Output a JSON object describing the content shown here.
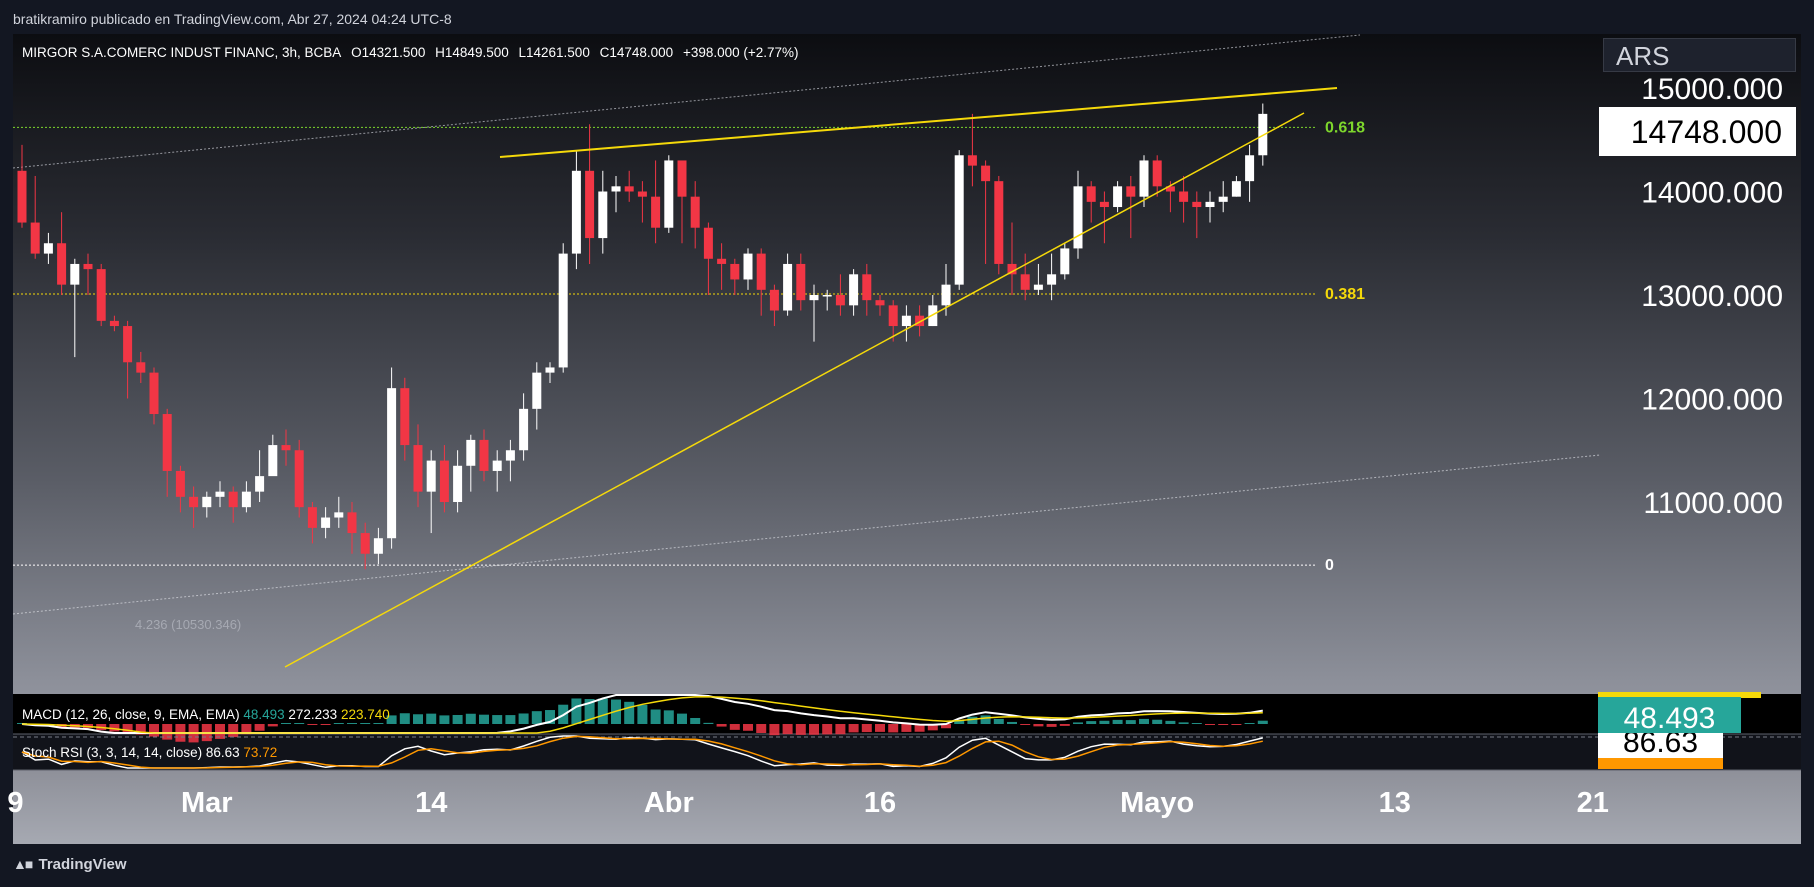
{
  "header": {
    "publish_line": "bratikramiro publicado en TradingView.com, Abr 27, 2024 04:24 UTC-8"
  },
  "legend": {
    "symbol": "MIRGOR S.A.COMERC INDUST FINANC, 3h, BCBA",
    "open": "O14321.500",
    "high": "H14849.500",
    "low": "L14261.500",
    "close": "C14748.000",
    "change": "+398.000 (+2.77%)"
  },
  "currency": "ARS",
  "last_price_tag": "14748.000",
  "macd": {
    "label": "MACD (12, 26, close, 9, EMA, EMA)",
    "hist_value": "48.493",
    "macd_value": "272.233",
    "signal_value": "223.740",
    "tag": "48.493"
  },
  "stoch_rsi": {
    "label": "Stoch RSI (3, 3, 14, 14, close)",
    "k_value": "86.63",
    "d_value": "73.72",
    "tag": "86.63"
  },
  "footer": {
    "brand": "TradingView"
  },
  "colors": {
    "up": "#ffffff",
    "down": "#f23645",
    "trendline": "#f5d90a",
    "fib_618": "#7dd62c",
    "fib_381": "#f5d90a",
    "macd_line": "#ffffff",
    "signal_line": "#f5d90a",
    "hist_pos": "#26a69a",
    "hist_neg": "#f23645",
    "rsi_k": "#ffffff",
    "rsi_d": "#ff9800"
  },
  "chart_data": {
    "type": "candlestick",
    "title": "MIRGOR S.A.COMERC INDUST FINANC, 3h, BCBA",
    "y_axis": {
      "ticks": [
        {
          "value": 11000,
          "label": "11000.000"
        },
        {
          "value": 12000,
          "label": "12000.000"
        },
        {
          "value": 13000,
          "label": "13000.000"
        },
        {
          "value": 14000,
          "label": "14000.000"
        },
        {
          "value": 15000,
          "label": "15000.000"
        }
      ],
      "range": [
        10000,
        15500
      ]
    },
    "x_axis": {
      "ticks": [
        {
          "i": -0.5,
          "label": "9"
        },
        {
          "i": 14,
          "label": "Mar"
        },
        {
          "i": 31,
          "label": "14"
        },
        {
          "i": 49,
          "label": "Abr"
        },
        {
          "i": 65,
          "label": "16"
        },
        {
          "i": 86,
          "label": "Mayo"
        },
        {
          "i": 104,
          "label": "13"
        },
        {
          "i": 119,
          "label": "21"
        }
      ]
    },
    "fib_levels": [
      {
        "label": "0.618",
        "value": 14620
      },
      {
        "label": "0.381",
        "value": 13010
      },
      {
        "label": "0",
        "value": 10390
      }
    ],
    "fib_extension_label": "4.236 (10530.346)",
    "candles": [
      [
        14200,
        13700,
        14450,
        13650
      ],
      [
        13700,
        13400,
        14150,
        13350
      ],
      [
        13400,
        13500,
        13600,
        13300
      ],
      [
        13500,
        13100,
        13800,
        13000
      ],
      [
        13100,
        13300,
        13350,
        12400
      ],
      [
        13300,
        13250,
        13400,
        13000
      ],
      [
        13250,
        12750,
        13300,
        12700
      ],
      [
        12750,
        12700,
        12800,
        12650
      ],
      [
        12700,
        12350,
        12750,
        12000
      ],
      [
        12350,
        12250,
        12450,
        12150
      ],
      [
        12250,
        11850,
        12300,
        11750
      ],
      [
        11850,
        11300,
        11900,
        11050
      ],
      [
        11300,
        11050,
        11350,
        10900
      ],
      [
        11050,
        10950,
        11150,
        10750
      ],
      [
        10950,
        11050,
        11100,
        10850
      ],
      [
        11050,
        11100,
        11200,
        10950
      ],
      [
        11100,
        10950,
        11150,
        10800
      ],
      [
        10950,
        11100,
        11200,
        10900
      ],
      [
        11100,
        11250,
        11500,
        11000
      ],
      [
        11250,
        11550,
        11650,
        11300
      ],
      [
        11550,
        11500,
        11700,
        11350
      ],
      [
        11500,
        10950,
        11600,
        10850
      ],
      [
        10950,
        10750,
        11000,
        10600
      ],
      [
        10750,
        10850,
        10950,
        10650
      ],
      [
        10850,
        10900,
        11050,
        10750
      ],
      [
        10900,
        10700,
        11000,
        10500
      ],
      [
        10700,
        10500,
        10800,
        10350
      ],
      [
        10500,
        10650,
        10750,
        10400
      ],
      [
        10650,
        12100,
        12300,
        10550
      ],
      [
        12100,
        11550,
        12200,
        11400
      ],
      [
        11550,
        11100,
        11750,
        10950
      ],
      [
        11100,
        11400,
        11500,
        10700
      ],
      [
        11400,
        11000,
        11550,
        10900
      ],
      [
        11000,
        11350,
        11500,
        10900
      ],
      [
        11350,
        11600,
        11650,
        11100
      ],
      [
        11600,
        11300,
        11700,
        11200
      ],
      [
        11300,
        11400,
        11500,
        11100
      ],
      [
        11400,
        11500,
        11600,
        11200
      ],
      [
        11500,
        11900,
        12050,
        11400
      ],
      [
        11900,
        12250,
        12350,
        11700
      ],
      [
        12250,
        12300,
        12350,
        12150
      ],
      [
        12300,
        13400,
        13500,
        12250
      ],
      [
        13400,
        14200,
        14400,
        13250
      ],
      [
        14200,
        13550,
        14650,
        13300
      ],
      [
        13550,
        14000,
        14200,
        13400
      ],
      [
        14000,
        14050,
        14150,
        13800
      ],
      [
        14050,
        14000,
        14200,
        13900
      ],
      [
        14000,
        13950,
        14100,
        13700
      ],
      [
        13950,
        13650,
        14300,
        13500
      ],
      [
        13650,
        14300,
        14350,
        13600
      ],
      [
        14300,
        13950,
        14250,
        13500
      ],
      [
        13950,
        13650,
        14100,
        13450
      ],
      [
        13650,
        13350,
        13700,
        13000
      ],
      [
        13350,
        13300,
        13500,
        13050
      ],
      [
        13300,
        13150,
        13350,
        13000
      ],
      [
        13150,
        13400,
        13450,
        13050
      ],
      [
        13400,
        13050,
        13450,
        12800
      ],
      [
        13050,
        12850,
        13100,
        12700
      ],
      [
        12850,
        13300,
        13400,
        12800
      ],
      [
        13300,
        12950,
        13400,
        12850
      ],
      [
        12950,
        13000,
        13100,
        12550
      ],
      [
        13000,
        13000,
        13050,
        12850
      ],
      [
        13000,
        12900,
        13200,
        12800
      ],
      [
        12900,
        13200,
        13250,
        12800
      ],
      [
        13200,
        12950,
        13300,
        12800
      ],
      [
        12950,
        12900,
        13000,
        12800
      ],
      [
        12900,
        12700,
        12950,
        12550
      ],
      [
        12700,
        12800,
        12900,
        12550
      ],
      [
        12800,
        12700,
        12900,
        12600
      ],
      [
        12700,
        12900,
        13000,
        12700
      ],
      [
        12900,
        13100,
        13300,
        12800
      ],
      [
        13100,
        14350,
        14400,
        13050
      ],
      [
        14350,
        14250,
        14750,
        14050
      ],
      [
        14250,
        14100,
        14300,
        13300
      ],
      [
        14100,
        13300,
        14150,
        13200
      ],
      [
        13300,
        13200,
        13700,
        13000
      ],
      [
        13200,
        13050,
        13400,
        12950
      ],
      [
        13050,
        13100,
        13300,
        13000
      ],
      [
        13100,
        13200,
        13400,
        12950
      ],
      [
        13200,
        13450,
        13500,
        13150
      ],
      [
        13450,
        14050,
        14200,
        13350
      ],
      [
        14050,
        13900,
        14100,
        13700
      ],
      [
        13900,
        13850,
        14000,
        13500
      ],
      [
        13850,
        14050,
        14100,
        13800
      ],
      [
        14050,
        13950,
        14150,
        13550
      ],
      [
        13950,
        14300,
        14350,
        13850
      ],
      [
        14300,
        14050,
        14350,
        13950
      ],
      [
        14050,
        14000,
        14100,
        13800
      ],
      [
        14000,
        13900,
        14150,
        13700
      ],
      [
        13900,
        13850,
        14000,
        13550
      ],
      [
        13850,
        13900,
        14000,
        13700
      ],
      [
        13900,
        13950,
        14100,
        13800
      ],
      [
        13950,
        14100,
        14150,
        13950
      ],
      [
        14100,
        14350,
        14450,
        13900
      ],
      [
        14350,
        14750,
        14850,
        14250
      ]
    ]
  }
}
